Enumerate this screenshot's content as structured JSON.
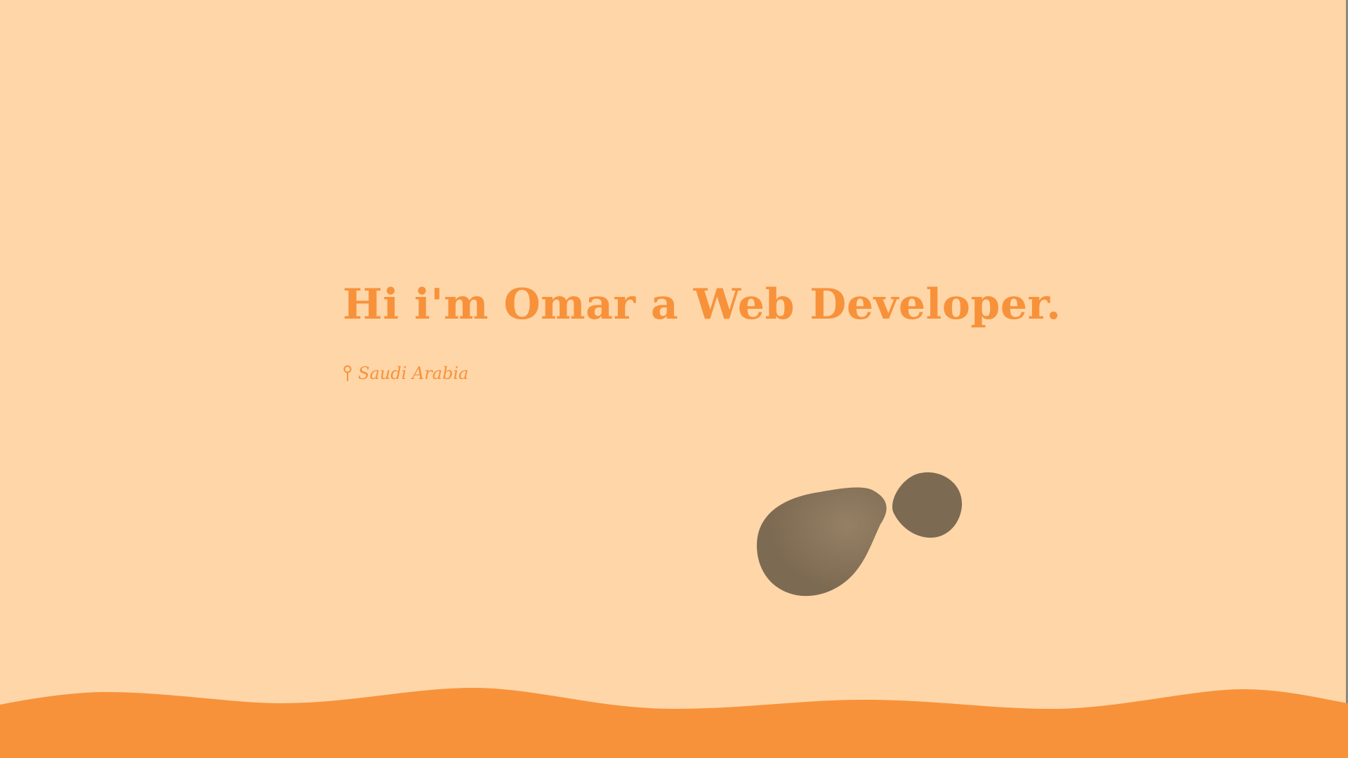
{
  "hero": {
    "title": "Hi i'm Omar a Web Developer.",
    "location": "Saudi Arabia",
    "location_icon": "map-pin-icon"
  },
  "colors": {
    "background": "#ffd6a8",
    "accent": "#f7923b",
    "blob": "#7d6a52"
  }
}
